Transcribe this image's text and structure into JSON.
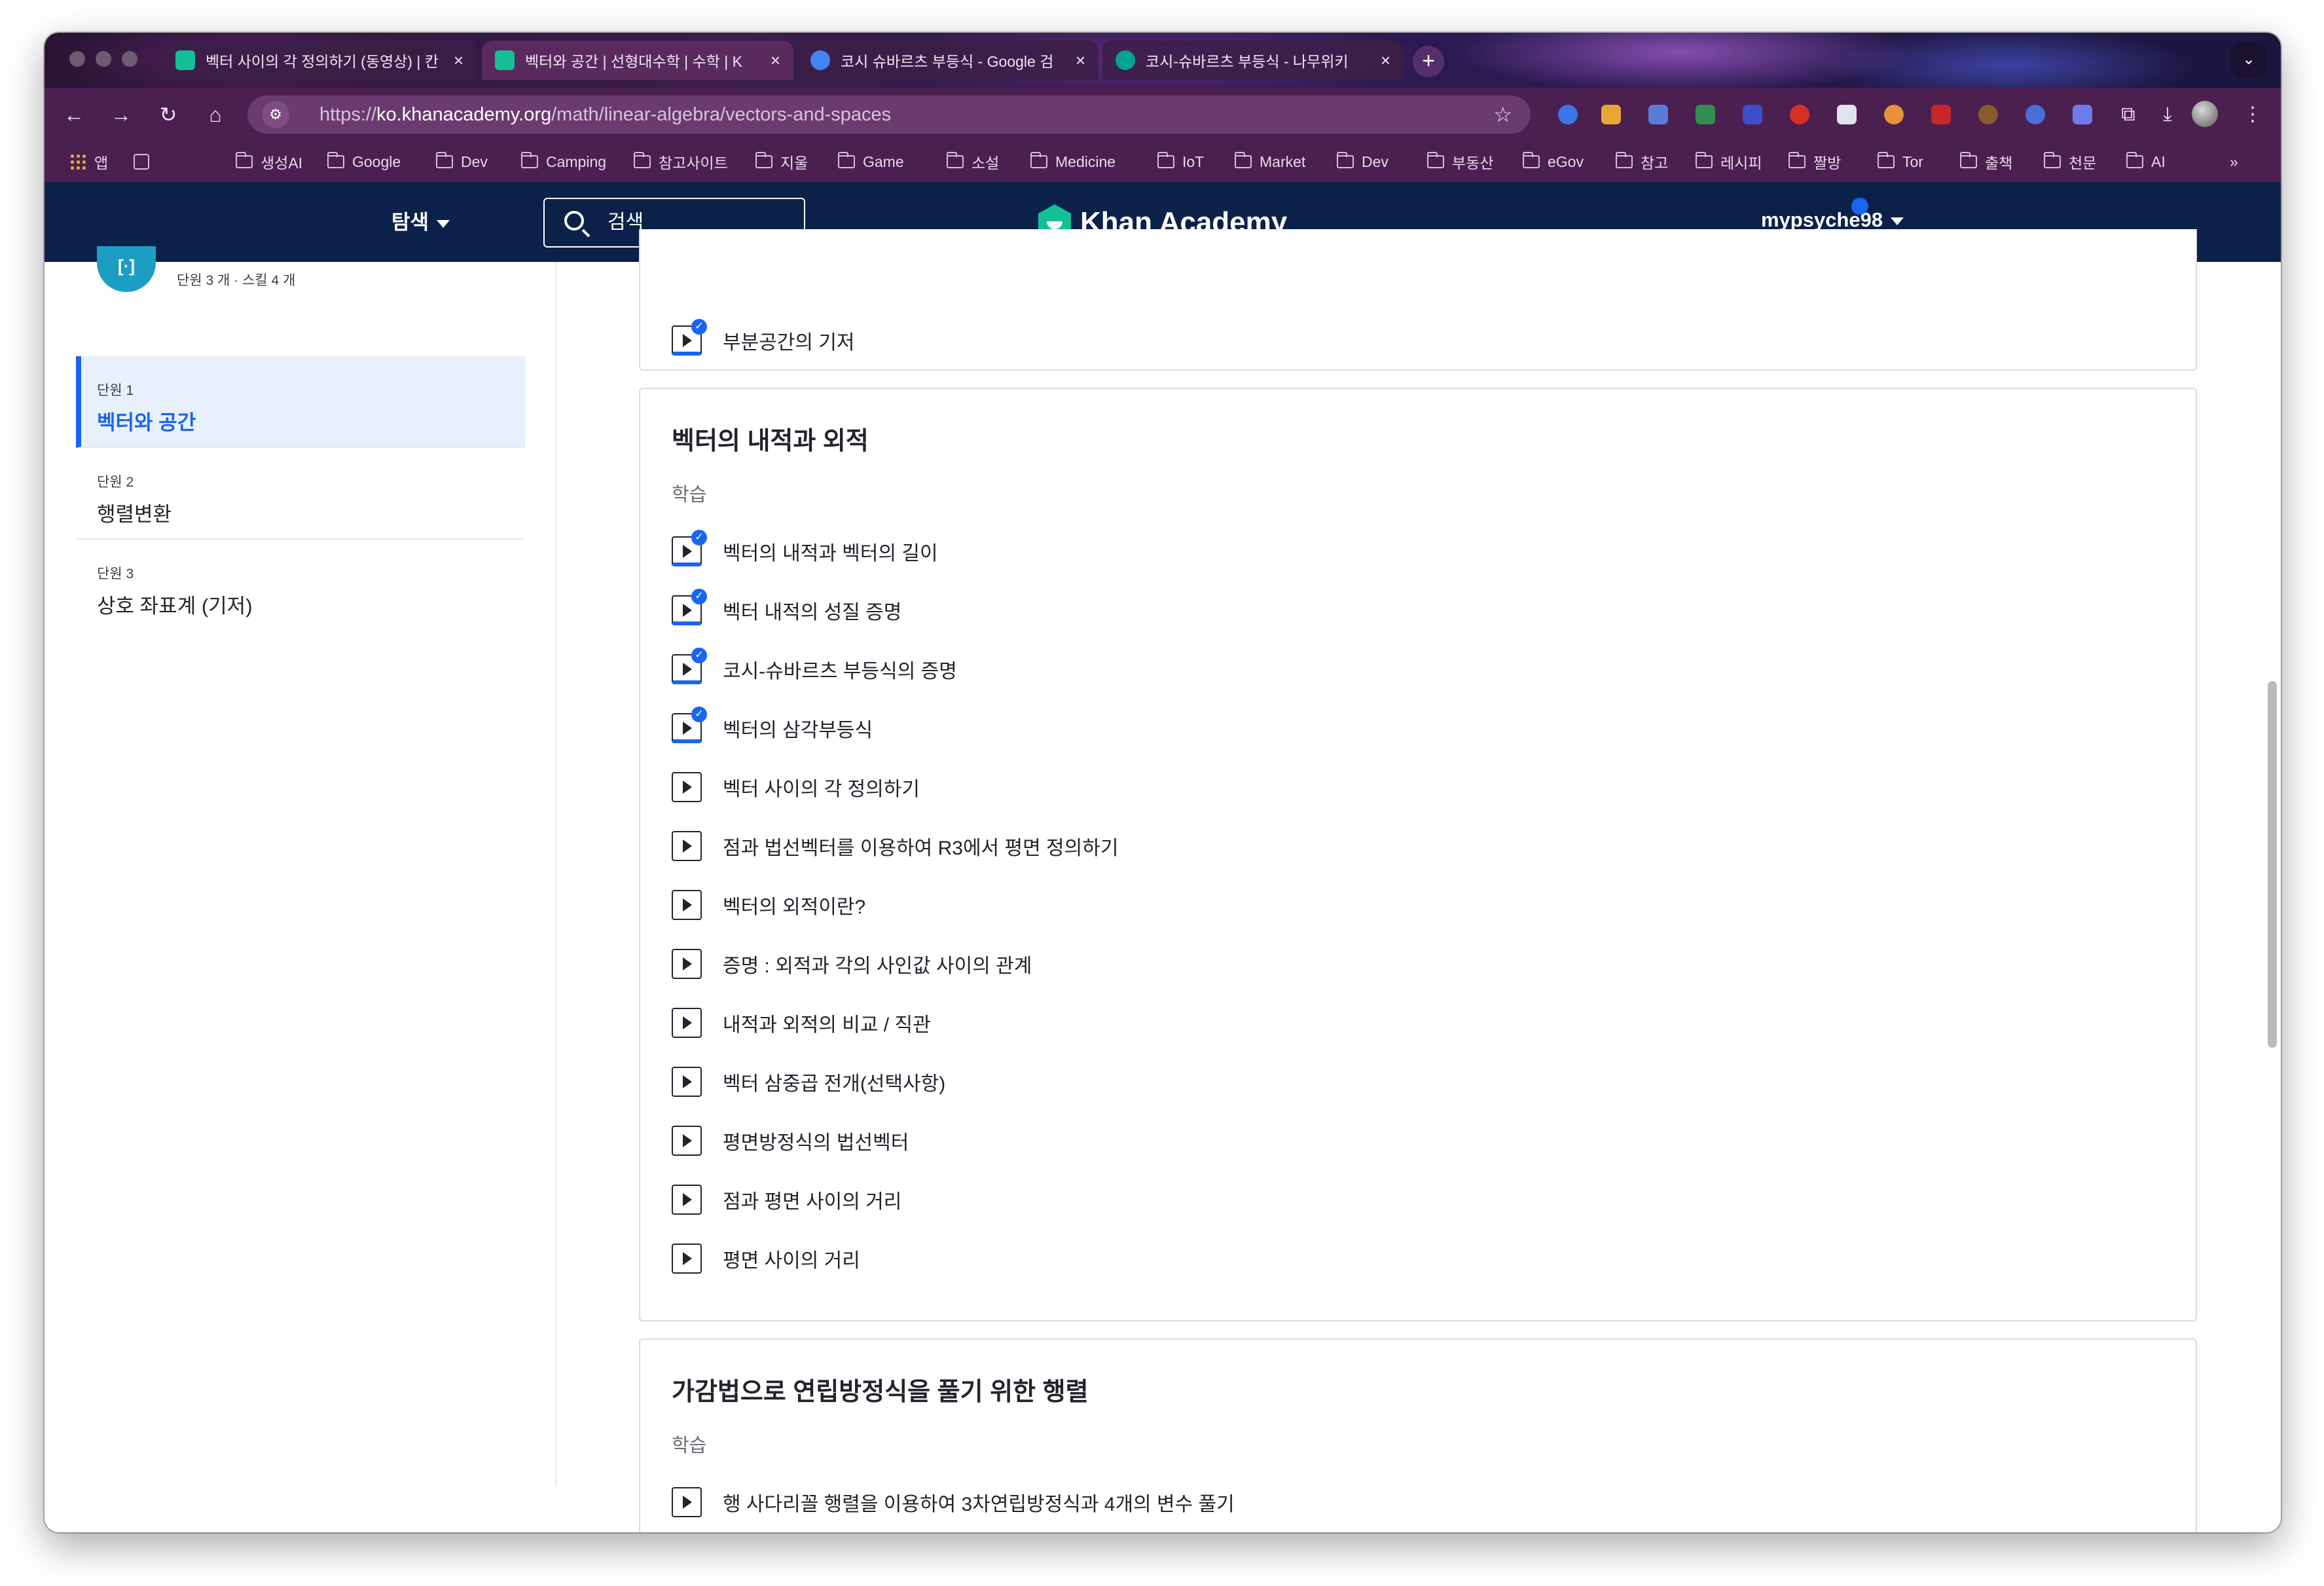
{
  "browser": {
    "tabs": [
      {
        "title": "벡터 사이의 각 정의하기 (동영상) | 칸",
        "favicon_color": "#14bf96",
        "active": false
      },
      {
        "title": "벡터와 공간 | 선형대수학 | 수학 | K",
        "favicon_color": "#14bf96",
        "active": true
      },
      {
        "title": "코시 슈바르츠 부등식 - Google 검",
        "favicon_color": "#4285f4",
        "active": false
      },
      {
        "title": "코시-슈바르츠 부등식 - 나무위키",
        "favicon_color": "#00a495",
        "active": false
      }
    ],
    "new_tab": "+",
    "tab_menu": "⌄",
    "url_scheme": "https://",
    "url_domain": "ko.khanacademy.org",
    "url_path": "/math/linear-algebra/vectors-and-spaces",
    "bookmarks": [
      "앱",
      "생성AI",
      "Google",
      "Dev",
      "Camping",
      "참고사이트",
      "지울",
      "Game",
      "소설",
      "Medicine",
      "IoT",
      "Market",
      "Dev",
      "부동산",
      "eGov",
      "참고",
      "레시피",
      "짤방",
      "Tor",
      "출책",
      "천문",
      "AI"
    ],
    "bookmarks_more": "»"
  },
  "header": {
    "explore": "탐색",
    "search": "검색",
    "logo": "Khan Academy",
    "username": "mypsyche98",
    "brand_color": "#0b2149"
  },
  "sidebar": {
    "course_icon": "[·]",
    "counts": "단원 3 개 · 스킬 4 개",
    "units": [
      {
        "label": "단원 1",
        "name": "벡터와 공간",
        "active": true
      },
      {
        "label": "단원 2",
        "name": "행렬변환",
        "active": false
      },
      {
        "label": "단원 3",
        "name": "상호 좌표계 (기저)",
        "active": false
      }
    ]
  },
  "content": {
    "top_item": {
      "label": "부분공간의 기저",
      "done": true
    },
    "section1": {
      "title": "벡터의 내적과 외적",
      "subtitle": "학습",
      "items": [
        {
          "label": "벡터의 내적과 벡터의 길이",
          "done": true
        },
        {
          "label": "벡터 내적의 성질 증명",
          "done": true
        },
        {
          "label": "코시-슈바르츠 부등식의 증명",
          "done": true
        },
        {
          "label": "벡터의 삼각부등식",
          "done": true
        },
        {
          "label": "벡터 사이의 각 정의하기",
          "done": false
        },
        {
          "label": "점과 법선벡터를 이용하여 R3에서 평면 정의하기",
          "done": false
        },
        {
          "label": "벡터의 외적이란?",
          "done": false
        },
        {
          "label": "증명 : 외적과 각의 사인값 사이의 관계",
          "done": false
        },
        {
          "label": "내적과 외적의 비교 / 직관",
          "done": false
        },
        {
          "label": "벡터 삼중곱 전개(선택사항)",
          "done": false
        },
        {
          "label": "평면방정식의 법선벡터",
          "done": false
        },
        {
          "label": "점과 평면 사이의 거리",
          "done": false
        },
        {
          "label": "평면 사이의 거리",
          "done": false
        }
      ]
    },
    "section2": {
      "title": "가감법으로 연립방정식을 풀기 위한 행렬",
      "subtitle": "학습",
      "items": [
        {
          "label": "행 사다리꼴 행렬을 이용하여 3차연립방정식과 4개의 변수 풀기",
          "done": false
        }
      ]
    }
  }
}
